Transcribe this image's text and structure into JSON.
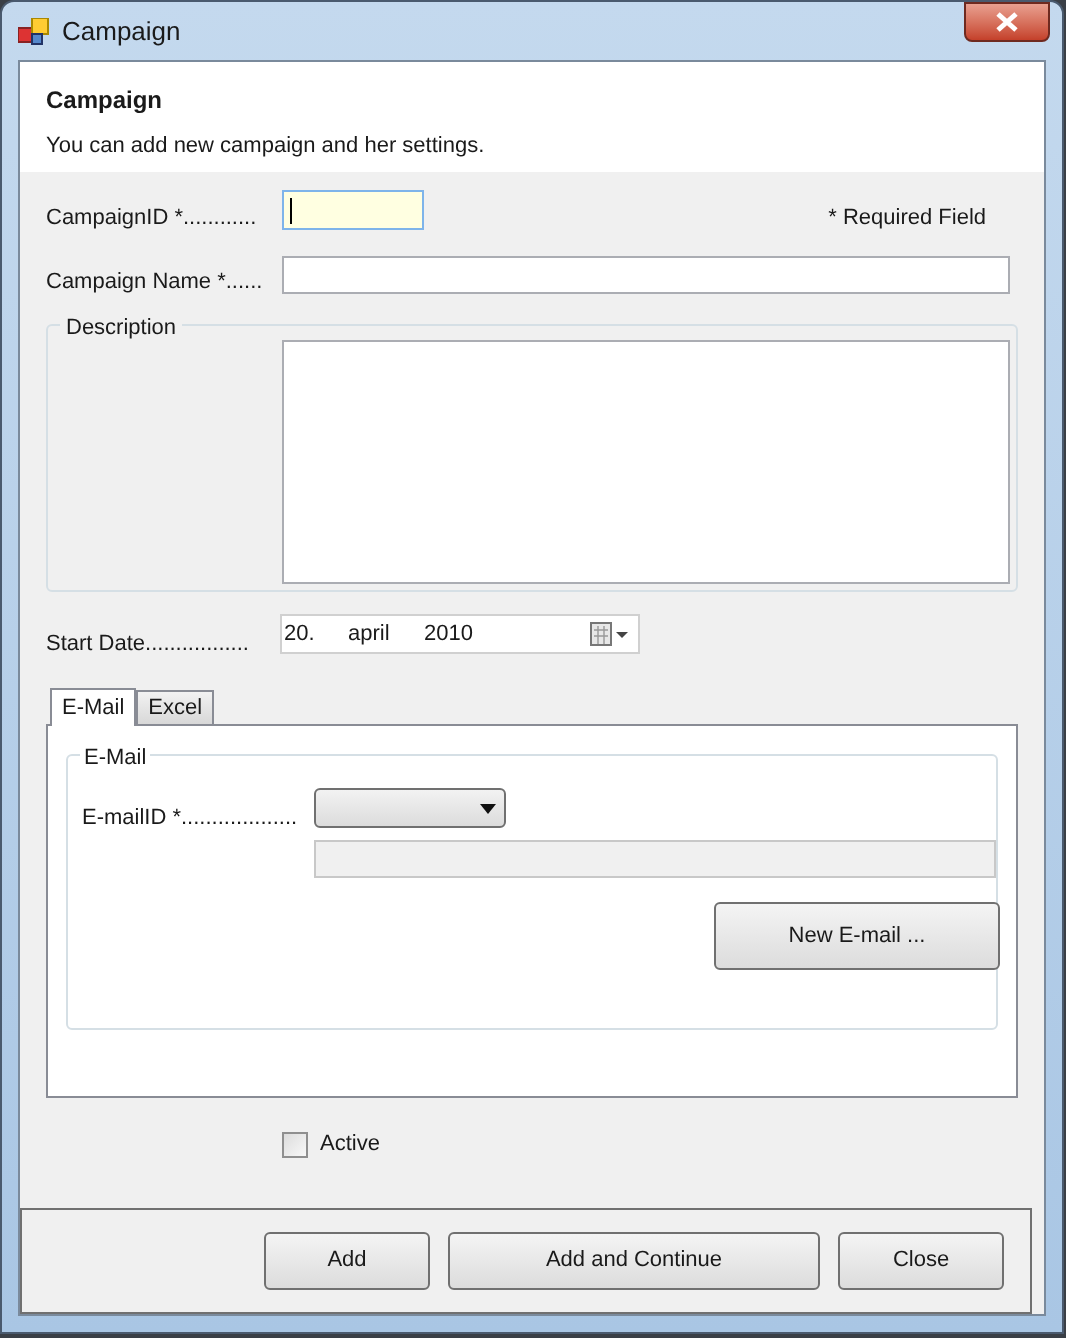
{
  "window": {
    "title": "Campaign"
  },
  "header": {
    "title": "Campaign",
    "subtitle": "You can add new campaign and her settings."
  },
  "campaign_id": {
    "label": "CampaignID *............",
    "focused": true
  },
  "required_note": "* Required Field",
  "campaign_name": {
    "label": "Campaign Name *......",
    "focused": false
  },
  "description": {
    "title": "Description"
  },
  "start_date": {
    "label": "Start Date.................",
    "day": "20.",
    "month": "april",
    "year": "2010"
  },
  "tabs": [
    {
      "label": "E-Mail",
      "selected": true
    },
    {
      "label": "Excel",
      "selected": false
    }
  ],
  "email_group": {
    "title": "E-Mail",
    "email_id_label": "E-mailID *...................",
    "new_email_button": "New E-mail ..."
  },
  "active": {
    "label": "Active",
    "checked": false
  },
  "buttons": [
    "Add",
    "Add and Continue",
    "Close"
  ]
}
